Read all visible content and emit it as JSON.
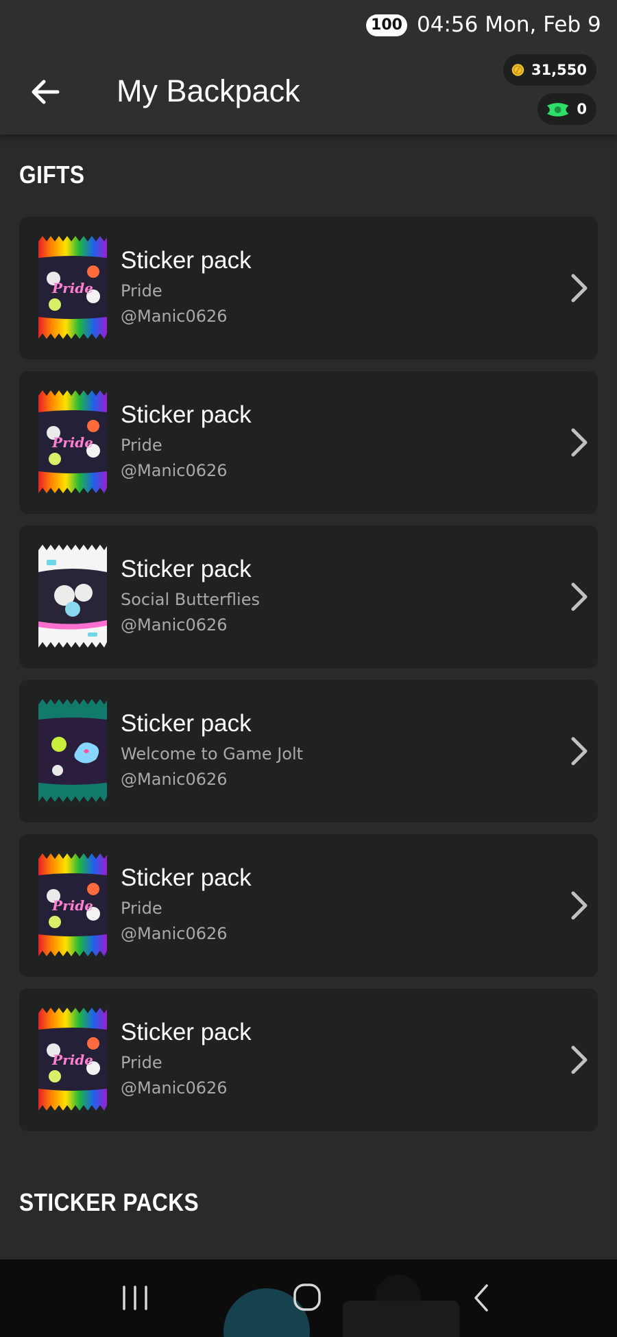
{
  "status_bar": {
    "battery": "100",
    "time_date": "04:56  Mon, Feb 9"
  },
  "header": {
    "title": "My Backpack",
    "coins": "31,550",
    "gems": "0",
    "back_icon": "arrow-left-icon"
  },
  "sections": {
    "gifts": "GIFTS",
    "sticker_packs": "STICKER PACKS"
  },
  "gifts": [
    {
      "title": "Sticker pack",
      "subtitle": "Pride",
      "user": "@Manic0626",
      "art": "pride"
    },
    {
      "title": "Sticker pack",
      "subtitle": "Pride",
      "user": "@Manic0626",
      "art": "pride"
    },
    {
      "title": "Sticker pack",
      "subtitle": "Social Butterflies",
      "user": "@Manic0626",
      "art": "butterflies"
    },
    {
      "title": "Sticker pack",
      "subtitle": "Welcome to Game Jolt",
      "user": "@Manic0626",
      "art": "welcome"
    },
    {
      "title": "Sticker pack",
      "subtitle": "Pride",
      "user": "@Manic0626",
      "art": "pride"
    },
    {
      "title": "Sticker pack",
      "subtitle": "Pride",
      "user": "@Manic0626",
      "art": "pride"
    }
  ],
  "colors": {
    "background": "#292b2a",
    "card": "#202221",
    "app_bar": "#2d302f",
    "muted_text": "#a7aaa8",
    "coin": "#f2c12e",
    "gem": "#2ee06a"
  }
}
